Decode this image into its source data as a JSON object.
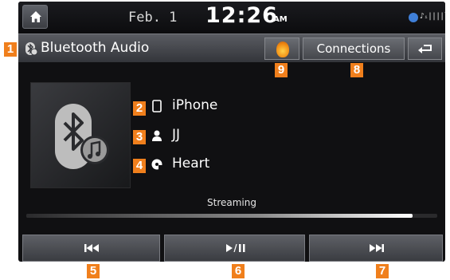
{
  "status_bar": {
    "date": "Feb.  1",
    "time": "12:26",
    "ampm": "AM",
    "icons": [
      "bluetooth-icon",
      "signal-bars-icon"
    ],
    "signal_text": "♪ᵢ||||ᵀᵃ"
  },
  "title_bar": {
    "title": "Bluetooth Audio",
    "connections_label": "Connections"
  },
  "track": {
    "device": "iPhone",
    "artist": "JJ",
    "title": "Heart",
    "status": "Streaming",
    "progress_fraction": 0.94
  },
  "controls": {
    "prev_icon": "previous-track-icon",
    "play_pause_icon": "play-pause-icon",
    "next_icon": "next-track-icon"
  },
  "callouts": [
    "1",
    "2",
    "3",
    "4",
    "5",
    "6",
    "7",
    "8",
    "9"
  ],
  "colors": {
    "accent": "#f07f1c",
    "bluetooth": "#3f7fd8",
    "background": "#101012"
  }
}
